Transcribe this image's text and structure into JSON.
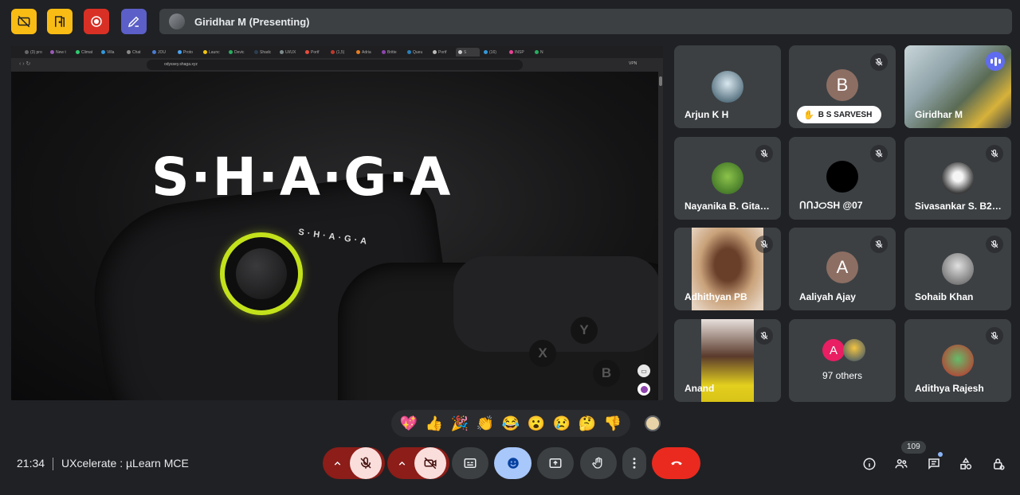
{
  "presenting_bar": {
    "label": "Giridhar M (Presenting)"
  },
  "shared_screen": {
    "tabs": [
      "(3) pro",
      "New t",
      "Climat",
      "Villa",
      "Chat",
      "JOU",
      "Proto",
      "Launc",
      "Devic",
      "Shadc",
      "UI/UX",
      "Portf",
      "(1,5)",
      "Adria",
      "Britte",
      "Queu",
      "Portf",
      "S",
      "(16)",
      "INSP",
      "N"
    ],
    "url": "odyssey.shaga.xyz",
    "vpn_label": "VPN",
    "hero_title": "S·H·A·G·A",
    "controller_label": "S·H·A·G·A",
    "face_buttons": [
      "Y",
      "X",
      "B"
    ]
  },
  "participants": [
    {
      "name": "Arjun K H",
      "muted": false,
      "avatar": "photo"
    },
    {
      "name": "B S SARVESH",
      "muted": true,
      "avatar": "letter",
      "letter": "B",
      "pill": true
    },
    {
      "name": "Giridhar M",
      "muted": false,
      "avatar": "video",
      "speaking": true
    },
    {
      "name": "Nayanika B. Gitanjali",
      "muted": true,
      "avatar": "photo"
    },
    {
      "name": "ᑎᑎJᝪSH @07",
      "muted": true,
      "avatar": "black"
    },
    {
      "name": "Sivasankar S. B22...",
      "muted": true,
      "avatar": "photo"
    },
    {
      "name": "Adhithyan PB",
      "muted": true,
      "avatar": "video"
    },
    {
      "name": "Aaliyah Ajay",
      "muted": true,
      "avatar": "letter",
      "letter": "A"
    },
    {
      "name": "Sohaib Khan",
      "muted": true,
      "avatar": "photo"
    },
    {
      "name": "Anand",
      "muted": true,
      "avatar": "video"
    },
    {
      "name": "97 others",
      "muted": false,
      "avatar": "group",
      "letter": "A"
    },
    {
      "name": "Adithya Rajesh",
      "muted": true,
      "avatar": "photo"
    }
  ],
  "reactions": [
    "💖",
    "👍",
    "🎉",
    "👏",
    "😂",
    "😮",
    "😢",
    "🤔",
    "👎"
  ],
  "meeting": {
    "time": "21:34",
    "title": "UXcelerate : µLearn MCE"
  },
  "participant_count": "109",
  "colors": {
    "end_call": "#ea2a1f",
    "muted_red": "#f9dedc",
    "accent_blue": "#8ab4f8",
    "reactions_active": "#a8c7fa"
  }
}
